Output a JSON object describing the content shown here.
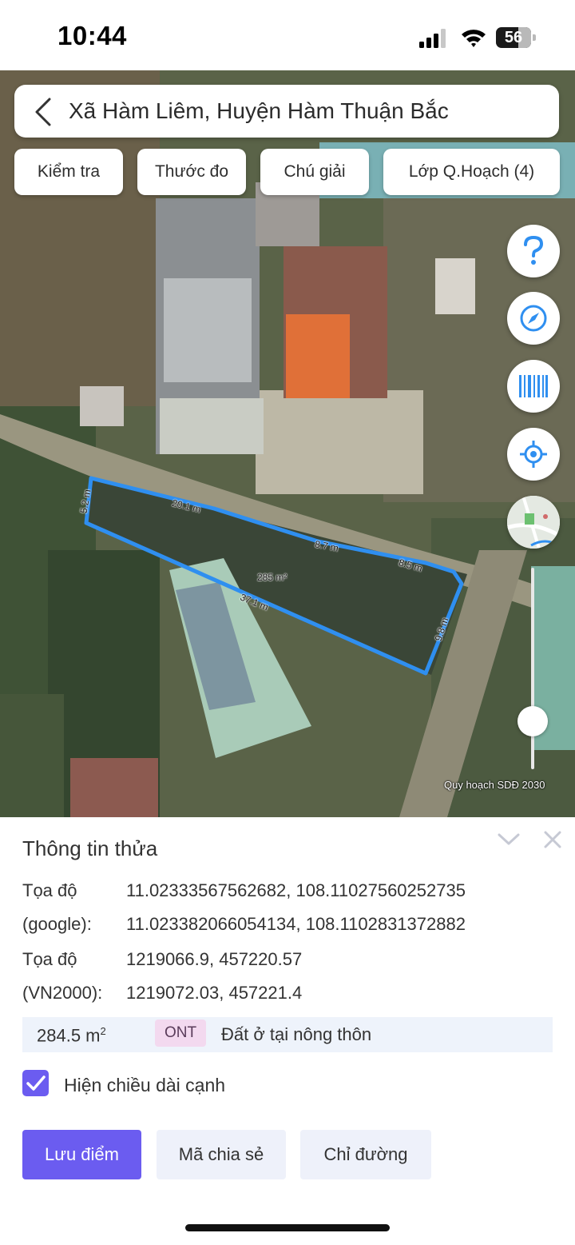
{
  "status_bar": {
    "time": "10:44",
    "battery": "56"
  },
  "search": {
    "location": "Xã Hàm Liêm, Huyện Hàm Thuận Bắc"
  },
  "toolbar": {
    "chips": [
      "Kiểm tra",
      "Thước đo",
      "Chú giải",
      "Lớp Q.Hoạch (4)"
    ]
  },
  "map": {
    "caption": "Quy hoạch SDĐ 2030",
    "edge_lengths": [
      "5.2 m",
      "20.1 m",
      "8.7 m",
      "8.5 m",
      "9.8 m",
      "37.1 m"
    ],
    "area_label": "285 m²",
    "controls": [
      "help-icon",
      "compass-icon",
      "barcode-icon",
      "locate-icon",
      "basemap-thumbnail"
    ],
    "parcel_color": "#2f8ff0"
  },
  "panel": {
    "title": "Thông tin thửa",
    "coord_google_label_1": "Tọa độ",
    "coord_google_label_2": "(google):",
    "coord_google_1": "11.02333567562682, 108.11027560252735",
    "coord_google_2": "11.023382066054134, 108.1102831372882",
    "coord_vn_label_1": "Tọa độ",
    "coord_vn_label_2": "(VN2000):",
    "coord_vn_1": "1219066.9, 457220.57",
    "coord_vn_2": "1219072.03, 457221.4",
    "area_value": "284.5 m",
    "area_unit_sup": "2",
    "land_code": "ONT",
    "land_use": "Đất ở tại nông thôn",
    "show_edges_label": "Hiện chiều dài cạnh",
    "show_edges_checked": true,
    "buttons": {
      "save": "Lưu điểm",
      "share": "Mã chia sẻ",
      "directions": "Chỉ đường"
    }
  },
  "colors": {
    "accent": "#6b5cf0",
    "area_bg": "#eef3fb",
    "badge_bg": "#f3d9ef"
  }
}
